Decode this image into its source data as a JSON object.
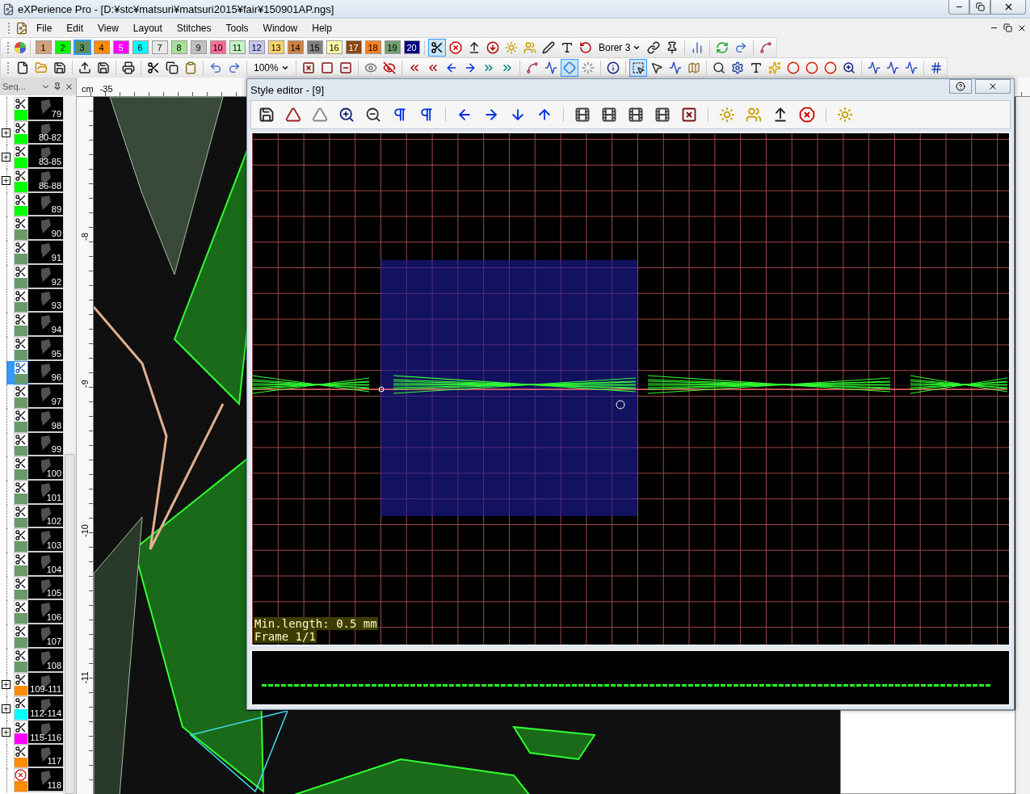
{
  "window": {
    "title": "eXPerience Pro - [D:¥stc¥matsuri¥matsuri2015¥fair¥150901AP.ngs]"
  },
  "menu": [
    "File",
    "Edit",
    "View",
    "Layout",
    "Stitches",
    "Tools",
    "Window",
    "Help"
  ],
  "palette": [
    {
      "label": "1",
      "color": "#d2a07a",
      "selected": false
    },
    {
      "label": "2",
      "color": "#00ff00",
      "selected": false
    },
    {
      "label": "3",
      "color": "#5f8f5f",
      "selected": true
    },
    {
      "label": "4",
      "color": "#ff8c00",
      "selected": false
    },
    {
      "label": "5",
      "color": "#ff00ff",
      "selected": false
    },
    {
      "label": "6",
      "color": "#00ffff",
      "selected": false
    },
    {
      "label": "7",
      "color": "#e8e8e8",
      "selected": false
    },
    {
      "label": "8",
      "color": "#a8e098",
      "selected": false
    },
    {
      "label": "9",
      "color": "#c0c0c0",
      "selected": false
    },
    {
      "label": "10",
      "color": "#ff6a96",
      "selected": false
    },
    {
      "label": "11",
      "color": "#c4f4c4",
      "selected": false
    },
    {
      "label": "12",
      "color": "#c4c4f4",
      "selected": false
    },
    {
      "label": "13",
      "color": "#ffd468",
      "selected": false
    },
    {
      "label": "14",
      "color": "#d08040",
      "selected": false
    },
    {
      "label": "15",
      "color": "#808080",
      "selected": false
    },
    {
      "label": "16",
      "color": "#ffffa8",
      "selected": false
    },
    {
      "label": "17",
      "color": "#8b4513",
      "selected": false
    },
    {
      "label": "18",
      "color": "#ff8020",
      "selected": false
    },
    {
      "label": "19",
      "color": "#70a070",
      "selected": false
    },
    {
      "label": "20",
      "color": "#000080",
      "selected": false
    }
  ],
  "toolbar_1": [
    {
      "kind": "scissors",
      "selected": true
    },
    {
      "kind": "stop-sign",
      "selected": false
    },
    {
      "kind": "arrow-up-line",
      "selected": false
    },
    {
      "kind": "circle-arrow-down",
      "selected": false
    },
    {
      "kind": "sun",
      "selected": false
    },
    {
      "kind": "users",
      "selected": false
    },
    {
      "kind": "pen",
      "selected": false
    },
    {
      "kind": "text",
      "selected": false
    },
    {
      "kind": "rotate",
      "selected": false
    },
    {
      "kind": "dropdown",
      "label": "Borer 3"
    },
    {
      "kind": "link",
      "selected": false
    },
    {
      "kind": "pin",
      "selected": false
    },
    {
      "kind": "separator"
    },
    {
      "kind": "bar-chart",
      "selected": false
    },
    {
      "kind": "separator"
    },
    {
      "kind": "refresh",
      "selected": false
    },
    {
      "kind": "redo",
      "selected": false
    },
    {
      "kind": "separator"
    },
    {
      "kind": "spline",
      "selected": false
    }
  ],
  "toolbar_2": [
    {
      "kind": "file",
      "selected": false
    },
    {
      "kind": "folder",
      "selected": false
    },
    {
      "kind": "save",
      "selected": false
    },
    {
      "kind": "separator"
    },
    {
      "kind": "upload",
      "selected": false
    },
    {
      "kind": "save",
      "selected": false
    },
    {
      "kind": "separator"
    },
    {
      "kind": "printer",
      "selected": false
    },
    {
      "kind": "separator"
    },
    {
      "kind": "scissors",
      "selected": false
    },
    {
      "kind": "copy",
      "selected": false
    },
    {
      "kind": "clipboard",
      "selected": false
    },
    {
      "kind": "separator"
    },
    {
      "kind": "undo",
      "selected": false
    },
    {
      "kind": "redo",
      "selected": false
    },
    {
      "kind": "separator"
    },
    {
      "kind": "dropdown",
      "label": "100%"
    },
    {
      "kind": "separator"
    },
    {
      "kind": "square-x",
      "selected": false
    },
    {
      "kind": "square",
      "selected": false
    },
    {
      "kind": "square-minus",
      "selected": false
    },
    {
      "kind": "separator"
    },
    {
      "kind": "eye",
      "selected": false
    },
    {
      "kind": "eye-off",
      "selected": false
    },
    {
      "kind": "separator"
    },
    {
      "kind": "chevrons-left",
      "selected": false
    },
    {
      "kind": "chevrons-left",
      "selected": false
    },
    {
      "kind": "arrow-left",
      "selected": false
    },
    {
      "kind": "arrow-right",
      "selected": false
    },
    {
      "kind": "chevrons-right",
      "selected": false
    },
    {
      "kind": "chevrons-right",
      "selected": false
    },
    {
      "kind": "separator"
    },
    {
      "kind": "spline",
      "selected": false
    },
    {
      "kind": "zigzag",
      "selected": false
    },
    {
      "kind": "diamond",
      "selected": true
    },
    {
      "kind": "loader",
      "selected": false
    },
    {
      "kind": "separator"
    },
    {
      "kind": "info",
      "selected": false
    },
    {
      "kind": "separator"
    },
    {
      "kind": "select-box",
      "selected": true
    },
    {
      "kind": "pointer",
      "selected": false
    },
    {
      "kind": "zigzag",
      "selected": false
    },
    {
      "kind": "map",
      "selected": false
    },
    {
      "kind": "separator"
    },
    {
      "kind": "search",
      "selected": false
    },
    {
      "kind": "settings",
      "selected": false
    },
    {
      "kind": "text",
      "selected": false
    },
    {
      "kind": "sparkles",
      "selected": false
    },
    {
      "kind": "circle",
      "selected": false
    },
    {
      "kind": "circle",
      "selected": false
    },
    {
      "kind": "circle",
      "selected": false
    },
    {
      "kind": "zoom-in",
      "selected": false
    },
    {
      "kind": "separator"
    },
    {
      "kind": "zigzag",
      "selected": false
    },
    {
      "kind": "zigzag",
      "selected": false
    },
    {
      "kind": "zigzag",
      "selected": false
    },
    {
      "kind": "separator"
    },
    {
      "kind": "hash",
      "selected": false
    }
  ],
  "sequence_panel": {
    "title": "Seq...",
    "items": [
      {
        "label": "79",
        "color": "#00ff00",
        "kind": "stitch",
        "selected": false
      },
      {
        "label": "80-82",
        "color": "#00ff00",
        "kind": "stitch",
        "selected": false,
        "expanded": false
      },
      {
        "label": "83-85",
        "color": "#00ff00",
        "kind": "stitch",
        "selected": false,
        "expanded": false
      },
      {
        "label": "86-88",
        "color": "#00ff00",
        "kind": "stitch",
        "selected": false,
        "expanded": false
      },
      {
        "label": "89",
        "color": "#00ff00",
        "kind": "stitch",
        "selected": false
      },
      {
        "label": "90",
        "color": "#6a9a6a",
        "kind": "stitch",
        "selected": false
      },
      {
        "label": "91",
        "color": "#6a9a6a",
        "kind": "stitch",
        "selected": false
      },
      {
        "label": "92",
        "color": "#6a9a6a",
        "kind": "stitch",
        "selected": false
      },
      {
        "label": "93",
        "color": "#6a9a6a",
        "kind": "stitch",
        "selected": false
      },
      {
        "label": "94",
        "color": "#6a9a6a",
        "kind": "stitch",
        "selected": false
      },
      {
        "label": "95",
        "color": "#6a9a6a",
        "kind": "stitch",
        "selected": false
      },
      {
        "label": "96",
        "color": "#6a9a6a",
        "kind": "stitch",
        "selected": true
      },
      {
        "label": "97",
        "color": "#6a9a6a",
        "kind": "stitch",
        "selected": false
      },
      {
        "label": "98",
        "color": "#6a9a6a",
        "kind": "stitch",
        "selected": false
      },
      {
        "label": "99",
        "color": "#6a9a6a",
        "kind": "stitch",
        "selected": false
      },
      {
        "label": "100",
        "color": "#6a9a6a",
        "kind": "stitch",
        "selected": false
      },
      {
        "label": "101",
        "color": "#6a9a6a",
        "kind": "stitch",
        "selected": false
      },
      {
        "label": "102",
        "color": "#6a9a6a",
        "kind": "stitch",
        "selected": false
      },
      {
        "label": "103",
        "color": "#6a9a6a",
        "kind": "stitch",
        "selected": false
      },
      {
        "label": "104",
        "color": "#6a9a6a",
        "kind": "stitch",
        "selected": false
      },
      {
        "label": "105",
        "color": "#6a9a6a",
        "kind": "stitch",
        "selected": false
      },
      {
        "label": "106",
        "color": "#6a9a6a",
        "kind": "stitch",
        "selected": false
      },
      {
        "label": "107",
        "color": "#6a9a6a",
        "kind": "stitch",
        "selected": false
      },
      {
        "label": "108",
        "color": "#6a9a6a",
        "kind": "stitch",
        "selected": false
      },
      {
        "label": "109-111",
        "color": "#ff8c00",
        "kind": "stitch",
        "selected": false,
        "expanded": false
      },
      {
        "label": "112-114",
        "color": "#00ffff",
        "kind": "stitch",
        "selected": false,
        "expanded": false
      },
      {
        "label": "115-116",
        "color": "#ff00ff",
        "kind": "stitch",
        "selected": false,
        "expanded": false
      },
      {
        "label": "117",
        "color": "#ff8c00",
        "kind": "stitch",
        "selected": false
      },
      {
        "label": "118",
        "color": "#ff8c00",
        "kind": "stop",
        "selected": false
      }
    ]
  },
  "ruler": {
    "unit": "cm",
    "top_label": "-35",
    "side_labels": [
      "-8",
      "-9",
      "-10",
      "-11"
    ]
  },
  "style_editor": {
    "title": "Style editor -  [9]",
    "toolbar": [
      {
        "kind": "save",
        "selected": false
      },
      {
        "kind": "triangle-plus",
        "selected": false
      },
      {
        "kind": "triangle-minus",
        "selected": false
      },
      {
        "kind": "zoom-in",
        "selected": false
      },
      {
        "kind": "zoom-out",
        "selected": false
      },
      {
        "kind": "pilcrow",
        "selected": false
      },
      {
        "kind": "pilcrow",
        "selected": false
      },
      {
        "kind": "separator"
      },
      {
        "kind": "arrow-left",
        "selected": false
      },
      {
        "kind": "arrow-right",
        "selected": false
      },
      {
        "kind": "arrow-down",
        "selected": false
      },
      {
        "kind": "arrow-up",
        "selected": false
      },
      {
        "kind": "separator"
      },
      {
        "kind": "film",
        "selected": false
      },
      {
        "kind": "film",
        "selected": false
      },
      {
        "kind": "film",
        "selected": false
      },
      {
        "kind": "film",
        "selected": false
      },
      {
        "kind": "square-x",
        "selected": false
      },
      {
        "kind": "separator"
      },
      {
        "kind": "sun",
        "selected": false
      },
      {
        "kind": "users",
        "selected": false
      },
      {
        "kind": "arrow-up-line",
        "selected": false
      },
      {
        "kind": "stop-sign",
        "selected": false
      },
      {
        "kind": "separator"
      },
      {
        "kind": "sun",
        "selected": false
      }
    ],
    "info_lines": [
      "Min.length: 0.5 mm",
      "Frame 1/1"
    ]
  }
}
